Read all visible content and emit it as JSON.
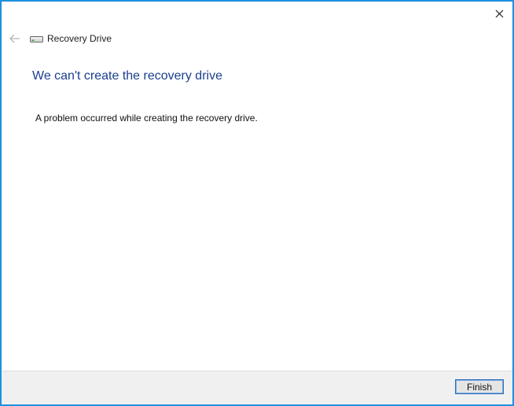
{
  "window": {
    "title": "Recovery Drive",
    "close_icon": "close-icon",
    "back_icon": "back-arrow-icon",
    "app_icon": "drive-icon"
  },
  "main": {
    "heading": "We can't create the recovery drive",
    "message": "A problem occurred while creating the recovery drive."
  },
  "footer": {
    "finish_label": "Finish"
  },
  "colors": {
    "border": "#1e90e0",
    "heading": "#1a3f8f",
    "footer_bg": "#f0f0f0"
  }
}
